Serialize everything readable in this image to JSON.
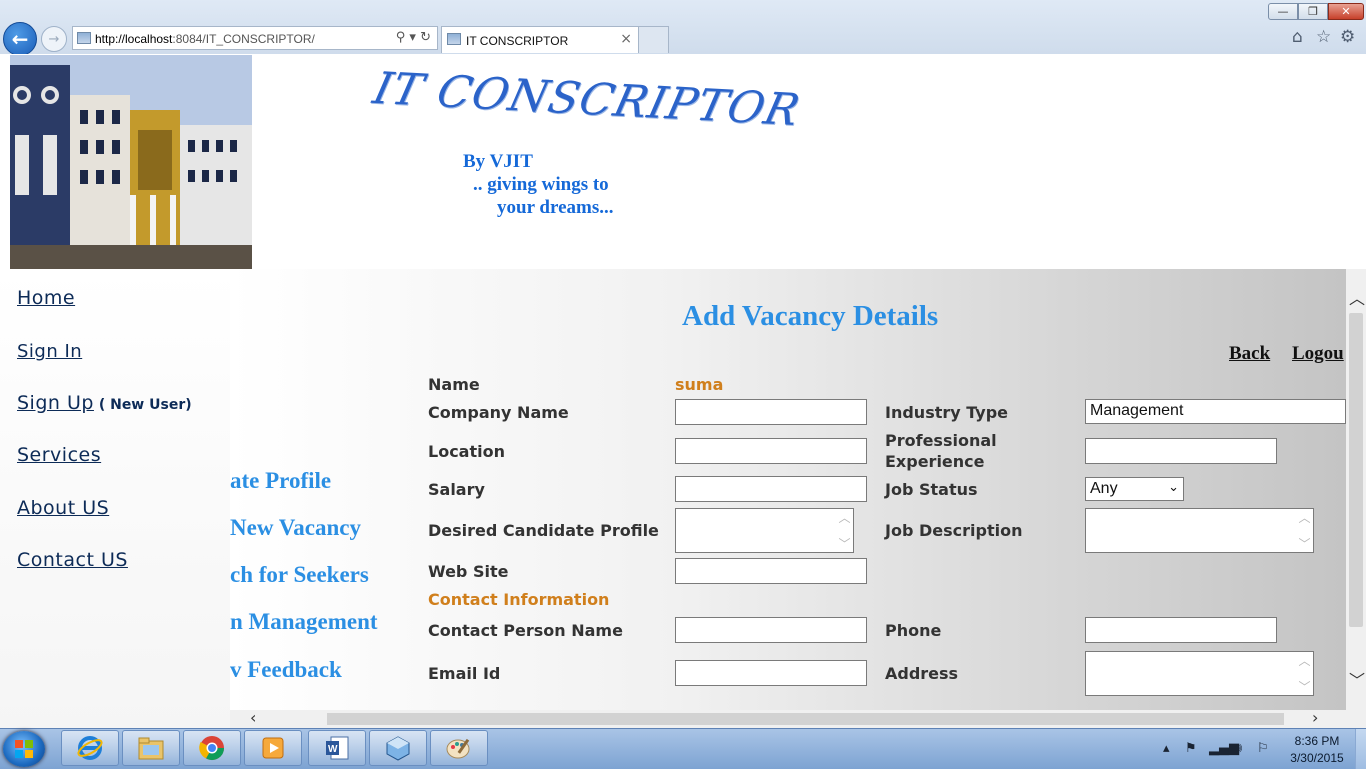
{
  "browser": {
    "url_host": "http://localhost",
    "url_rest": ":8084/IT_CONSCRIPTOR/",
    "tab_title": "IT CONSCRIPTOR",
    "tab_close": "×",
    "address_tools": "⚲ ▾ ↻",
    "window_min": "—",
    "window_max": "❐",
    "window_close": "✕",
    "icons": [
      "home-icon",
      "favorites-star-icon",
      "tools-gear-icon"
    ]
  },
  "header": {
    "site_title": "IT CONSCRIPTOR",
    "tagline_1": "By VJIT",
    "tagline_2": ".. giving wings to",
    "tagline_3": "your dreams..."
  },
  "left_nav": {
    "home": "Home",
    "sign_in": "Sign In",
    "sign_up": "Sign Up",
    "sign_up_note": " ( New User)",
    "services": "Services",
    "about": "About US",
    "contact": "Contact US"
  },
  "side_menu": {
    "item_1": "ate Profile",
    "item_2": " New Vacancy",
    "item_3": "ch for Seekers",
    "item_4": "n Management",
    "item_5": "v Feedback"
  },
  "main": {
    "heading": "Add Vacancy Details",
    "back": "Back",
    "logout": "Logou"
  },
  "form": {
    "name_label": "Name",
    "name_value": "suma",
    "company_label": "Company Name",
    "company_value": "",
    "industry_label": "Industry Type",
    "industry_value": "Management",
    "location_label": "Location",
    "location_value": "",
    "experience_label_1": "Professional",
    "experience_label_2": "Experience",
    "experience_value": "",
    "salary_label": "Salary",
    "salary_value": "",
    "job_status_label": "Job Status",
    "job_status_value": "Any",
    "candidate_profile_label": "Desired Candidate Profile",
    "candidate_profile_value": "",
    "job_description_label": "Job Description",
    "job_description_value": "",
    "website_label": "Web Site",
    "website_value": "",
    "contact_info_heading": "Contact Information",
    "contact_person_label": "Contact Person Name",
    "contact_person_value": "",
    "phone_label": "Phone",
    "phone_value": "",
    "email_label": "Email Id",
    "email_value": "",
    "address_label": "Address",
    "address_value": ""
  },
  "taskbar": {
    "time": "8:36 PM",
    "date": "3/30/2015",
    "apps": [
      "internet-explorer-icon",
      "file-explorer-icon",
      "chrome-icon",
      "media-player-icon",
      "word-icon",
      "virtualbox-icon",
      "paint-icon"
    ]
  },
  "colors": {
    "heading": "#2b8fe3",
    "nav_link": "#0d2b57",
    "orange_text": "#d07f1c",
    "tagline": "#1569d8"
  }
}
